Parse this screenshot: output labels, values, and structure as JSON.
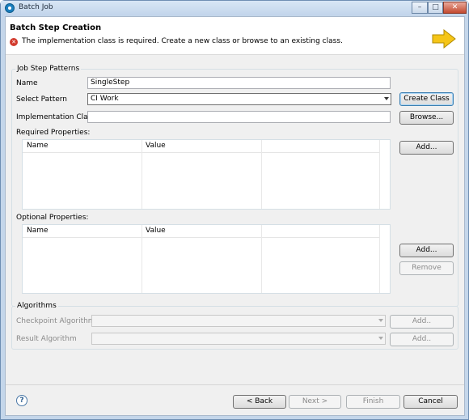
{
  "window": {
    "title": "Batch Job",
    "controls": {
      "minimize": "–",
      "maximize": "□",
      "close": "✕"
    }
  },
  "banner": {
    "title": "Batch Step Creation",
    "message": "The implementation class is required. Create a new class or browse to an existing class.",
    "icon": "error-icon"
  },
  "job_step_patterns": {
    "group_label": "Job Step Patterns",
    "name_label": "Name",
    "name_value": "SingleStep",
    "pattern_label": "Select Pattern",
    "pattern_value": "CI Work",
    "impl_label": "Implementation Class",
    "impl_value": "",
    "create_class": "Create Class",
    "browse": "Browse...",
    "required_label": "Required Properties:",
    "required_columns": [
      "Name",
      "Value"
    ],
    "required_add": "Add...",
    "optional_label": "Optional Properties:",
    "optional_columns": [
      "Name",
      "Value"
    ],
    "optional_add": "Add...",
    "optional_remove": "Remove"
  },
  "algorithms": {
    "group_label": "Algorithms",
    "checkpoint_label": "Checkpoint Algorithm",
    "checkpoint_value": "",
    "checkpoint_add": "Add..",
    "result_label": "Result Algorithm",
    "result_value": "",
    "result_add": "Add.."
  },
  "footer": {
    "help": "?",
    "back": "< Back",
    "next": "Next >",
    "finish": "Finish",
    "cancel": "Cancel"
  },
  "colors": {
    "accent": "#3c7fb1",
    "error": "#d23a2d",
    "arrow": "#f5c518"
  }
}
